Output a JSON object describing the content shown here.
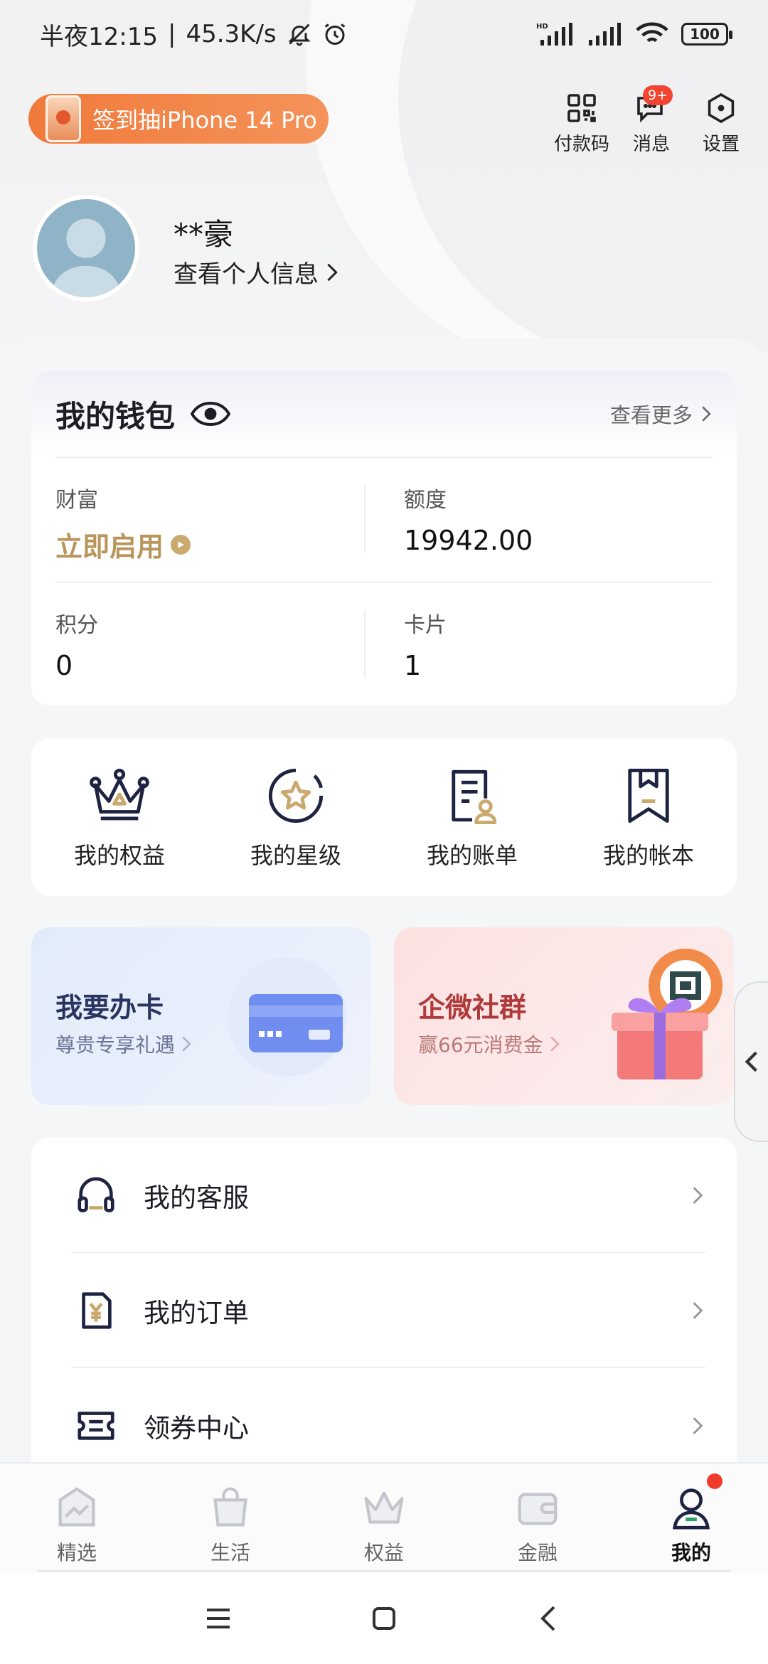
{
  "status_bar": {
    "time": "半夜12:15",
    "speed": "45.3K/s",
    "battery": "100",
    "hd": "HD"
  },
  "promo": {
    "label": "签到抽iPhone 14 Pro"
  },
  "top_actions": [
    {
      "label": "付款码",
      "icon": "qr-code-icon"
    },
    {
      "label": "消息",
      "icon": "message-icon",
      "badge": "9+"
    },
    {
      "label": "设置",
      "icon": "settings-icon"
    }
  ],
  "profile": {
    "name": "**豪",
    "info_link": "查看个人信息"
  },
  "wallet": {
    "title": "我的钱包",
    "more": "查看更多",
    "items": [
      {
        "label": "财富",
        "value": "立即启用"
      },
      {
        "label": "额度",
        "value": "19942.00"
      },
      {
        "label": "积分",
        "value": "0"
      },
      {
        "label": "卡片",
        "value": "1"
      }
    ]
  },
  "shortcuts": [
    {
      "label": "我的权益",
      "icon": "crown-icon"
    },
    {
      "label": "我的星级",
      "icon": "star-badge-icon"
    },
    {
      "label": "我的账单",
      "icon": "bill-icon"
    },
    {
      "label": "我的帐本",
      "icon": "bookmark-ledger-icon"
    }
  ],
  "banners": {
    "card": {
      "title": "我要办卡",
      "subtitle": "尊贵专享礼遇"
    },
    "group": {
      "title": "企微社群",
      "subtitle": "赢66元消费金"
    }
  },
  "menu": [
    {
      "label": "我的客服",
      "icon": "headset-icon"
    },
    {
      "label": "我的订单",
      "icon": "order-yen-icon"
    },
    {
      "label": "领券中心",
      "icon": "coupon-icon"
    }
  ],
  "bottom_nav": [
    {
      "label": "精选",
      "icon": "featured-icon"
    },
    {
      "label": "生活",
      "icon": "shopping-bag-icon"
    },
    {
      "label": "权益",
      "icon": "crown-nav-icon"
    },
    {
      "label": "金融",
      "icon": "wallet-icon"
    },
    {
      "label": "我的",
      "icon": "user-icon",
      "active": true
    }
  ],
  "colors": {
    "accent_gold": "#b8965a",
    "promo_orange": "#f07a3b",
    "navy": "#283560",
    "badge_red": "#f24430"
  }
}
